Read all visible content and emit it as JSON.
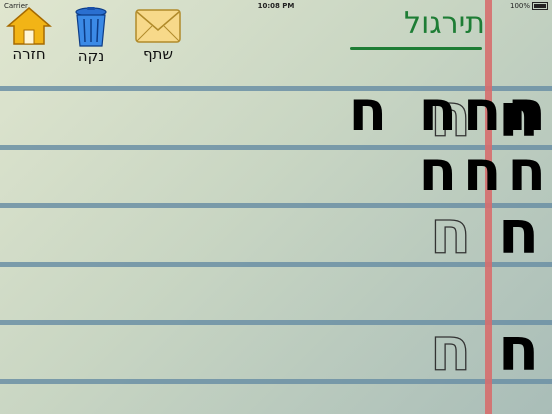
{
  "status_bar": {
    "carrier": "Carrier",
    "time": "10:08 PM",
    "battery": "100%"
  },
  "toolbar": {
    "home_label": "חזרה",
    "clear_label": "נקה",
    "share_label": "שתף"
  },
  "title": "תירגול",
  "rows": [
    {
      "model": "ח",
      "outline": "ח",
      "handwriting": "חחח ח חחח"
    },
    {
      "model": "ח",
      "outline": "ח"
    },
    {
      "model": "ח",
      "outline": "ח"
    }
  ],
  "colors": {
    "title": "#1e7d35",
    "rule_line": "#6b8fa5",
    "margin_line": "#d66e6e"
  }
}
